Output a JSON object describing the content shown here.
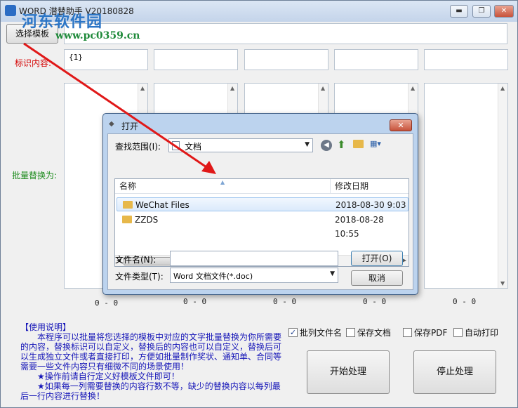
{
  "window": {
    "title": "WORD 潜替助手 V20180828",
    "minimize": "▬",
    "maximize": "❐",
    "close": "✕"
  },
  "watermark": {
    "brand": "河东软件园",
    "url": "www.pc0359.cn"
  },
  "template": {
    "button_label": "选择模板",
    "path_value": ""
  },
  "labels": {
    "marker": "标识内容:",
    "batch": "批量替换为:"
  },
  "columns": [
    {
      "marker_value": "{1}",
      "count": "0 - 0"
    },
    {
      "marker_value": "",
      "count": "0 - 0"
    },
    {
      "marker_value": "",
      "count": "0 - 0"
    },
    {
      "marker_value": "",
      "count": "0 - 0"
    },
    {
      "marker_value": "",
      "count": "0 - 0"
    }
  ],
  "help": {
    "heading": "【使用说明】",
    "p1": "本程序可以批量将您选择的模板中对应的文字批量替换为你所需要的内容，替换标识可以自定义，替换后的内容也可以自定义，替换后可以生成独立文件或者直接打印，方便如批量制作奖状、通知单、合同等需要一些文件内容只有细微不同的场景使用！",
    "p2": "★操作前请自行定义好模板文件即可！",
    "p3": "★如果每一列需要替换的内容行数不等，缺少的替换内容以每列最后一行内容进行替换！"
  },
  "options": {
    "batch_filename": {
      "label": "批列文件名",
      "checked": true
    },
    "save_doc": {
      "label": "保存文档",
      "checked": false
    },
    "save_pdf": {
      "label": "保存PDF",
      "checked": false
    },
    "auto_print": {
      "label": "自动打印",
      "checked": false
    }
  },
  "actions": {
    "start": "开始处理",
    "stop": "停止处理"
  },
  "dialog": {
    "title": "打开",
    "close": "✕",
    "lookin_label": "查找范围(I):",
    "lookin_value": "文档",
    "col_name": "名称",
    "col_date": "修改日期",
    "files": [
      {
        "name": "WeChat Files",
        "date": "2018-08-30 9:03",
        "selected": true
      },
      {
        "name": "ZZDS",
        "date": "2018-08-28 10:55",
        "selected": false
      }
    ],
    "filename_label": "文件名(N):",
    "filename_value": "",
    "filetype_label": "文件类型(T):",
    "filetype_value": "Word 文档文件(*.doc)",
    "open_button": "打开(O)",
    "cancel_button": "取消"
  },
  "colors": {
    "accent_red": "#d40000",
    "label_green": "#1a8a1a",
    "help_blue": "#1616b8",
    "annotation_arrow": "#e01818"
  }
}
